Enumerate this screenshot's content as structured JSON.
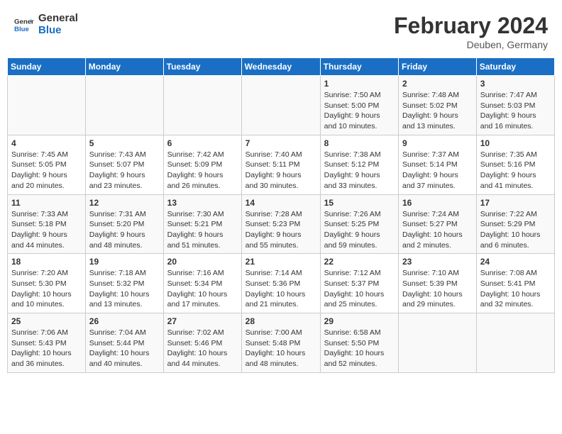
{
  "header": {
    "logo_line1": "General",
    "logo_line2": "Blue",
    "month": "February 2024",
    "location": "Deuben, Germany"
  },
  "weekdays": [
    "Sunday",
    "Monday",
    "Tuesday",
    "Wednesday",
    "Thursday",
    "Friday",
    "Saturday"
  ],
  "weeks": [
    [
      {
        "day": "",
        "text": ""
      },
      {
        "day": "",
        "text": ""
      },
      {
        "day": "",
        "text": ""
      },
      {
        "day": "",
        "text": ""
      },
      {
        "day": "1",
        "text": "Sunrise: 7:50 AM\nSunset: 5:00 PM\nDaylight: 9 hours\nand 10 minutes."
      },
      {
        "day": "2",
        "text": "Sunrise: 7:48 AM\nSunset: 5:02 PM\nDaylight: 9 hours\nand 13 minutes."
      },
      {
        "day": "3",
        "text": "Sunrise: 7:47 AM\nSunset: 5:03 PM\nDaylight: 9 hours\nand 16 minutes."
      }
    ],
    [
      {
        "day": "4",
        "text": "Sunrise: 7:45 AM\nSunset: 5:05 PM\nDaylight: 9 hours\nand 20 minutes."
      },
      {
        "day": "5",
        "text": "Sunrise: 7:43 AM\nSunset: 5:07 PM\nDaylight: 9 hours\nand 23 minutes."
      },
      {
        "day": "6",
        "text": "Sunrise: 7:42 AM\nSunset: 5:09 PM\nDaylight: 9 hours\nand 26 minutes."
      },
      {
        "day": "7",
        "text": "Sunrise: 7:40 AM\nSunset: 5:11 PM\nDaylight: 9 hours\nand 30 minutes."
      },
      {
        "day": "8",
        "text": "Sunrise: 7:38 AM\nSunset: 5:12 PM\nDaylight: 9 hours\nand 33 minutes."
      },
      {
        "day": "9",
        "text": "Sunrise: 7:37 AM\nSunset: 5:14 PM\nDaylight: 9 hours\nand 37 minutes."
      },
      {
        "day": "10",
        "text": "Sunrise: 7:35 AM\nSunset: 5:16 PM\nDaylight: 9 hours\nand 41 minutes."
      }
    ],
    [
      {
        "day": "11",
        "text": "Sunrise: 7:33 AM\nSunset: 5:18 PM\nDaylight: 9 hours\nand 44 minutes."
      },
      {
        "day": "12",
        "text": "Sunrise: 7:31 AM\nSunset: 5:20 PM\nDaylight: 9 hours\nand 48 minutes."
      },
      {
        "day": "13",
        "text": "Sunrise: 7:30 AM\nSunset: 5:21 PM\nDaylight: 9 hours\nand 51 minutes."
      },
      {
        "day": "14",
        "text": "Sunrise: 7:28 AM\nSunset: 5:23 PM\nDaylight: 9 hours\nand 55 minutes."
      },
      {
        "day": "15",
        "text": "Sunrise: 7:26 AM\nSunset: 5:25 PM\nDaylight: 9 hours\nand 59 minutes."
      },
      {
        "day": "16",
        "text": "Sunrise: 7:24 AM\nSunset: 5:27 PM\nDaylight: 10 hours\nand 2 minutes."
      },
      {
        "day": "17",
        "text": "Sunrise: 7:22 AM\nSunset: 5:29 PM\nDaylight: 10 hours\nand 6 minutes."
      }
    ],
    [
      {
        "day": "18",
        "text": "Sunrise: 7:20 AM\nSunset: 5:30 PM\nDaylight: 10 hours\nand 10 minutes."
      },
      {
        "day": "19",
        "text": "Sunrise: 7:18 AM\nSunset: 5:32 PM\nDaylight: 10 hours\nand 13 minutes."
      },
      {
        "day": "20",
        "text": "Sunrise: 7:16 AM\nSunset: 5:34 PM\nDaylight: 10 hours\nand 17 minutes."
      },
      {
        "day": "21",
        "text": "Sunrise: 7:14 AM\nSunset: 5:36 PM\nDaylight: 10 hours\nand 21 minutes."
      },
      {
        "day": "22",
        "text": "Sunrise: 7:12 AM\nSunset: 5:37 PM\nDaylight: 10 hours\nand 25 minutes."
      },
      {
        "day": "23",
        "text": "Sunrise: 7:10 AM\nSunset: 5:39 PM\nDaylight: 10 hours\nand 29 minutes."
      },
      {
        "day": "24",
        "text": "Sunrise: 7:08 AM\nSunset: 5:41 PM\nDaylight: 10 hours\nand 32 minutes."
      }
    ],
    [
      {
        "day": "25",
        "text": "Sunrise: 7:06 AM\nSunset: 5:43 PM\nDaylight: 10 hours\nand 36 minutes."
      },
      {
        "day": "26",
        "text": "Sunrise: 7:04 AM\nSunset: 5:44 PM\nDaylight: 10 hours\nand 40 minutes."
      },
      {
        "day": "27",
        "text": "Sunrise: 7:02 AM\nSunset: 5:46 PM\nDaylight: 10 hours\nand 44 minutes."
      },
      {
        "day": "28",
        "text": "Sunrise: 7:00 AM\nSunset: 5:48 PM\nDaylight: 10 hours\nand 48 minutes."
      },
      {
        "day": "29",
        "text": "Sunrise: 6:58 AM\nSunset: 5:50 PM\nDaylight: 10 hours\nand 52 minutes."
      },
      {
        "day": "",
        "text": ""
      },
      {
        "day": "",
        "text": ""
      }
    ]
  ]
}
